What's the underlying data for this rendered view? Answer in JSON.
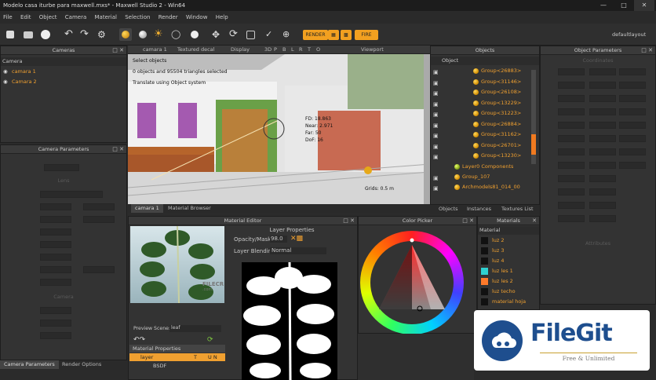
{
  "window": {
    "title": "Modelo casa iturbe para maxwell.mxs* - Maxwell Studio 2 - Win64"
  },
  "menu": [
    "File",
    "Edit",
    "Object",
    "Camera",
    "Material",
    "Selection",
    "Render",
    "Window",
    "Help"
  ],
  "toolbar": {
    "render_label": "RENDER",
    "fire_label": "FIRE",
    "layout": "defaultlayout"
  },
  "cameras": {
    "title": "Cameras",
    "header": "Camera",
    "items": [
      "camara 1",
      "Camara 2"
    ]
  },
  "camera_params": {
    "title": "Camera Parameters",
    "section": "Lens",
    "section2": "Camera"
  },
  "viewport": {
    "tabs": [
      "camara 1",
      "Textured decal",
      "Display",
      "3D",
      "P",
      "B",
      "L",
      "R",
      "T",
      "O"
    ],
    "title": "Viewport",
    "info": [
      "Select objects",
      "0 objects and 95504 triangles selected",
      "Translate using Object system"
    ],
    "camera_labels": [
      "FD: 18.863",
      "Near: 2.971",
      "Far: 50",
      "DoF: 16"
    ],
    "grid": "Grids: 0.5 m",
    "bottom_tabs": [
      "camara 1",
      "Material Browser"
    ]
  },
  "objects": {
    "title": "Objects",
    "header": "Object",
    "items": [
      "Group<26883>",
      "Group<31146>",
      "Group<26108>",
      "Group<13229>",
      "Group<31223>",
      "Group<26884>",
      "Group<31162>",
      "Group<26701>",
      "Group<13230>"
    ],
    "layer": "Layer0 Components",
    "extra": [
      "Group_107",
      "Archmodels81_014_00"
    ],
    "tabs": [
      "Objects",
      "Instances",
      "Textures List"
    ]
  },
  "object_params": {
    "title": "Object Parameters",
    "section": "Coordinates",
    "section2": "Attributes"
  },
  "material_editor": {
    "title": "Material Editor",
    "preview_label": "Preview Scene:",
    "preview_value": "leaf",
    "layer_props_title": "Layer Properties",
    "opacity_label": "Opacity/Mask",
    "opacity_value": "98.0",
    "blend_label": "Layer Blending",
    "blend_value": "Normal",
    "mat_props_title": "Material Properties",
    "col_layer": "layer",
    "col_t": "T",
    "col_un": "U N",
    "row_label": "BSDF"
  },
  "color_picker": {
    "title": "Color Picker"
  },
  "materials": {
    "title": "Materials",
    "header": "Material",
    "items": [
      "luz 2",
      "luz 3",
      "luz 4",
      "luz les 1",
      "luz les 2",
      "luz techo",
      "material hoja"
    ],
    "colors": [
      "#111111",
      "#111111",
      "#111111",
      "#2fd0d0",
      "#ff7a2a",
      "#111111",
      "#111111"
    ]
  },
  "bottom_tabs": [
    "Camera Parameters",
    "Render Options"
  ],
  "watermark_viewport": "FILECR",
  "watermark_viewport_sub": ".com",
  "filegit": {
    "name": "FileGit",
    "tagline": "Free & Unlimited"
  }
}
